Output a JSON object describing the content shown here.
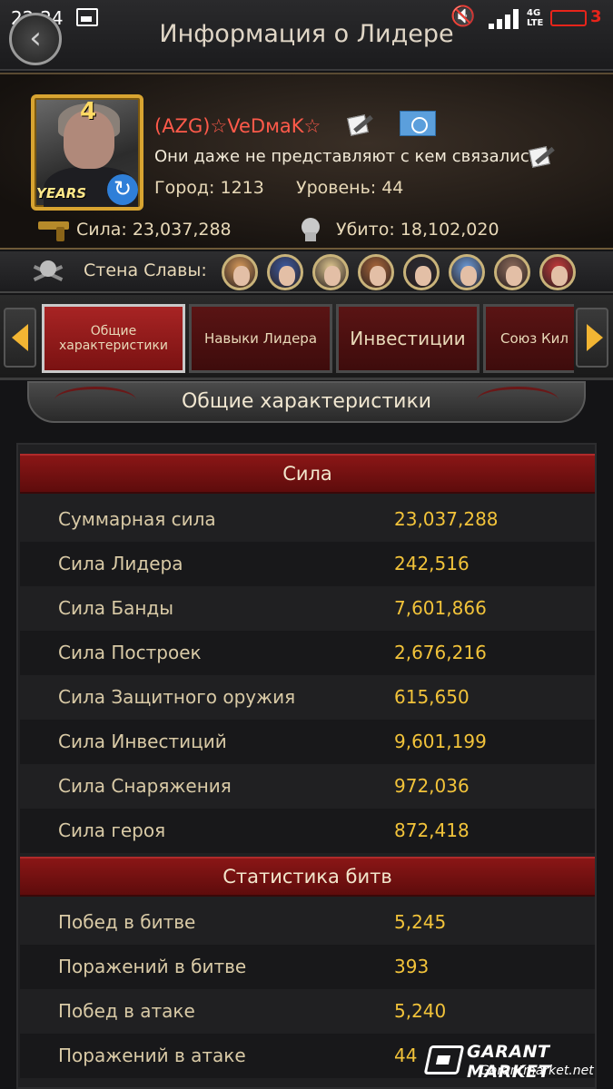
{
  "status_bar": {
    "time": "22:24",
    "network": "4G LTE",
    "battery": "3"
  },
  "header": {
    "title": "Информация о Лидере"
  },
  "profile": {
    "level_badge": "4",
    "years_badge": "YEARS",
    "name": "(AZG)☆VeDмaK☆",
    "motto": "Они даже не представляют с кем связались!",
    "city": "Город: 1213",
    "level": "Уровень: 44",
    "power": "Сила: 23,037,288",
    "kills": "Убито: 18,102,020"
  },
  "wall_of_fame": {
    "label": "Стена Славы:",
    "avatars": [
      "#d89a5a",
      "#3c5aa0",
      "#e0c890",
      "#a8663a",
      "#2a2a32",
      "#6a9ad8",
      "#8a6a5a",
      "#c43a3a"
    ]
  },
  "tabs": [
    {
      "label": "Общие характеристики",
      "active": true
    },
    {
      "label": "Навыки Лидера",
      "active": false
    },
    {
      "label": "Инвестиции",
      "active": false
    },
    {
      "label": "Союз Кил",
      "active": false
    }
  ],
  "section_title": "Общие характеристики",
  "groups": [
    {
      "title": "Сила",
      "rows": [
        {
          "label": "Суммарная сила",
          "value": "23,037,288"
        },
        {
          "label": "Сила Лидера",
          "value": "242,516"
        },
        {
          "label": "Сила Банды",
          "value": "7,601,866"
        },
        {
          "label": "Сила Построек",
          "value": "2,676,216"
        },
        {
          "label": "Сила Защитного оружия",
          "value": "615,650"
        },
        {
          "label": "Сила Инвестиций",
          "value": "9,601,199"
        },
        {
          "label": "Сила Снаряжения",
          "value": "972,036"
        },
        {
          "label": "Сила героя",
          "value": "872,418"
        }
      ]
    },
    {
      "title": "Статистика битв",
      "rows": [
        {
          "label": "Побед в битве",
          "value": "5,245"
        },
        {
          "label": "Поражений в битве",
          "value": "393"
        },
        {
          "label": "Побед в атаке",
          "value": "5,240"
        },
        {
          "label": "Поражений в атаке",
          "value": "44"
        }
      ]
    }
  ],
  "watermark": {
    "name": "GARANT MARKET",
    "url": "Garantmarket.net"
  },
  "colors": {
    "accent_red": "#8a1616",
    "value_gold": "#f2c33a",
    "name_red": "#ff5a4a"
  }
}
